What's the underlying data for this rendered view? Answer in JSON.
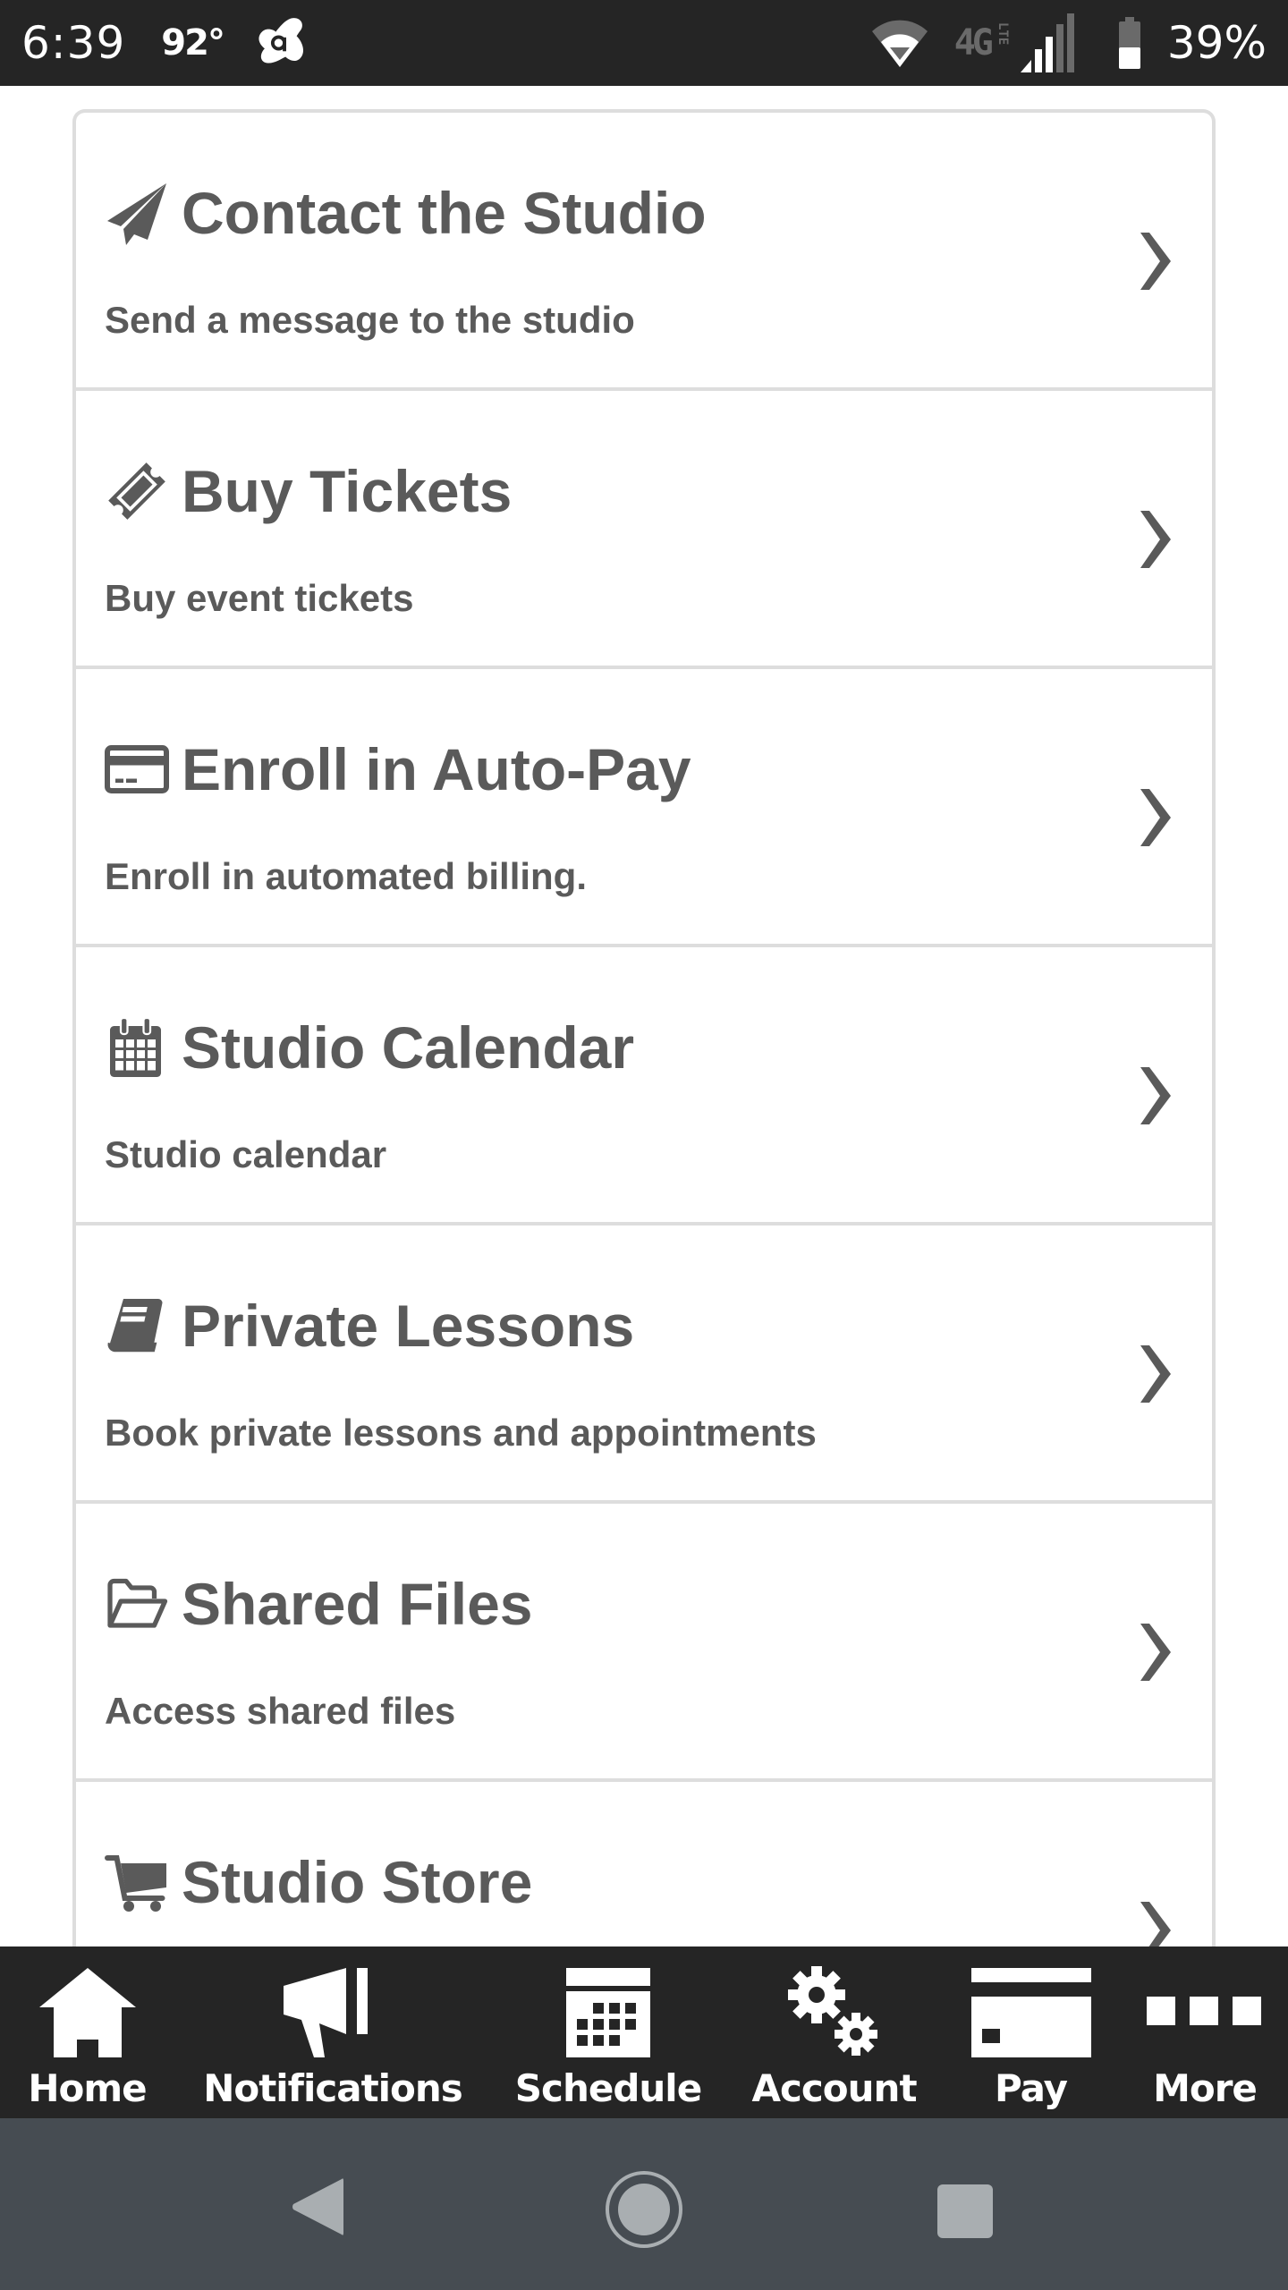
{
  "status_bar": {
    "time": "6:39",
    "temperature": "92°",
    "network": "4G",
    "network_sub": "LTE",
    "battery_percent": "39%",
    "battery_level": 0.39,
    "icons": [
      "avast-icon",
      "wifi-icon",
      "lte-icon",
      "signal-icon",
      "battery-icon"
    ]
  },
  "menu": {
    "items": [
      {
        "title": "Contact the Studio",
        "description": "Send a message to the studio",
        "icon": "paper-plane-icon"
      },
      {
        "title": "Buy Tickets",
        "description": "Buy event tickets",
        "icon": "ticket-icon"
      },
      {
        "title": "Enroll in Auto-Pay",
        "description": "Enroll in automated billing.",
        "icon": "credit-card-icon"
      },
      {
        "title": "Studio Calendar",
        "description": "Studio calendar",
        "icon": "calendar-icon"
      },
      {
        "title": "Private Lessons",
        "description": "Book private lessons and appointments",
        "icon": "book-icon"
      },
      {
        "title": "Shared Files",
        "description": "Access shared files",
        "icon": "folder-open-icon"
      },
      {
        "title": "Studio Store",
        "description": "",
        "icon": "shopping-cart-icon"
      }
    ]
  },
  "tabbar": {
    "tabs": [
      {
        "label": "Home",
        "icon": "home-icon"
      },
      {
        "label": "Notifications",
        "icon": "megaphone-icon"
      },
      {
        "label": "Schedule",
        "icon": "calendar-icon"
      },
      {
        "label": "Account",
        "icon": "gears-icon"
      },
      {
        "label": "Pay",
        "icon": "credit-card-icon"
      },
      {
        "label": "More",
        "icon": "more-icon"
      }
    ]
  },
  "navbar": {
    "buttons": [
      "back",
      "home",
      "recents"
    ]
  },
  "colors": {
    "text": "#5a5a5a",
    "border": "#dddddd",
    "tabbar_bg": "#252525",
    "navbar_bg": "#464c52",
    "nav_icon": "#a9aeb1"
  }
}
